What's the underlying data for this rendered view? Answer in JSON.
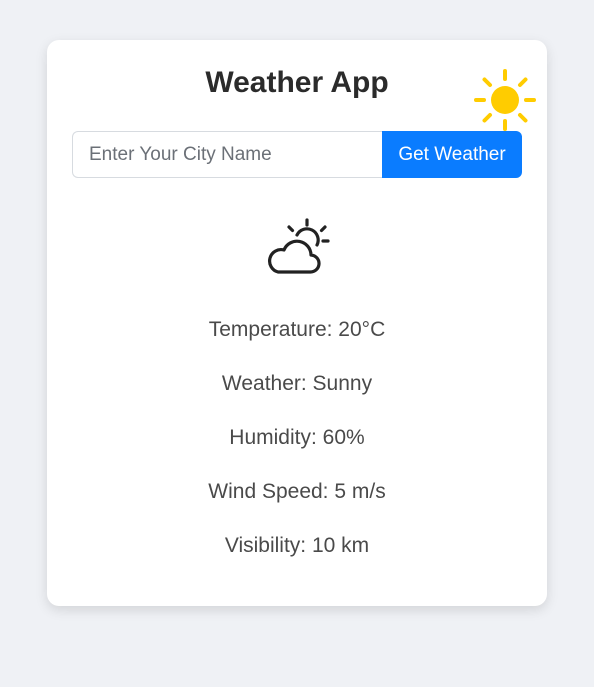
{
  "app": {
    "title": "Weather App"
  },
  "search": {
    "placeholder": "Enter Your City Name",
    "value": "",
    "button_label": "Get Weather"
  },
  "icons": {
    "header": "sun-icon",
    "condition": "partly-cloudy-icon"
  },
  "weather": {
    "temperature": "Temperature: 20°C",
    "condition": "Weather: Sunny",
    "humidity": "Humidity: 60%",
    "wind_speed": "Wind Speed: 5 m/s",
    "visibility": "Visibility: 10 km"
  },
  "colors": {
    "accent": "#0a7cff",
    "sun": "#ffcc00",
    "background": "#eff1f5"
  }
}
